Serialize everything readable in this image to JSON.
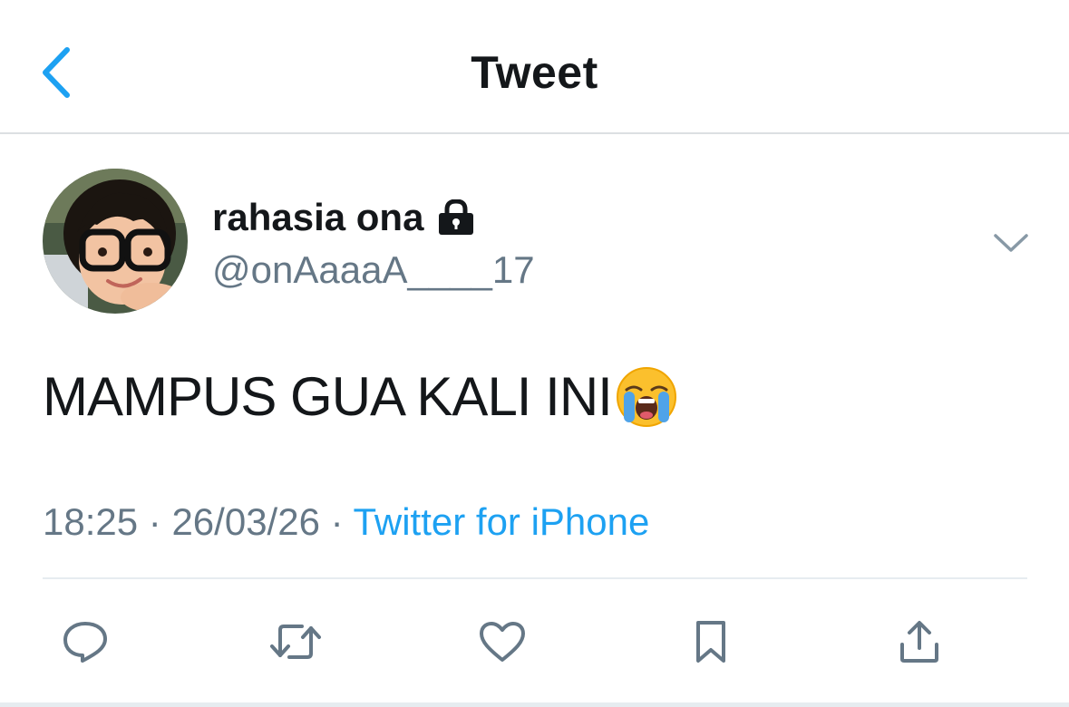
{
  "nav": {
    "title": "Tweet",
    "back_icon": "chevron-left-icon"
  },
  "tweet": {
    "author": {
      "display_name": "rahasia ona",
      "handle": "@onAaaaA____17",
      "protected_icon": "lock-icon",
      "avatar": "profile-photo-child-with-glasses"
    },
    "text": "MAMPUS GUA KALI INI",
    "emoji": "loudly-crying-face-emoji",
    "time": "18:25",
    "separator": "·",
    "date": "26/03/26",
    "source": "Twitter for iPhone"
  },
  "actions": [
    {
      "name": "reply",
      "icon": "comment-icon"
    },
    {
      "name": "retweet",
      "icon": "retweet-icon"
    },
    {
      "name": "like",
      "icon": "heart-icon"
    },
    {
      "name": "bookmark",
      "icon": "bookmark-icon"
    },
    {
      "name": "share",
      "icon": "share-icon"
    }
  ],
  "colors": {
    "accent": "#1da1f2",
    "secondary_text": "#657786",
    "icon_gray": "#657786",
    "divider": "#e6ecf0"
  }
}
